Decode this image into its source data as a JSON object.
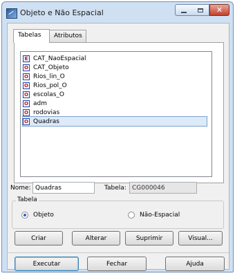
{
  "window": {
    "title": "Objeto e Não Espacial"
  },
  "tabs": [
    {
      "label": "Tabelas"
    },
    {
      "label": "Atributos"
    }
  ],
  "list": {
    "items": [
      {
        "icon": "E",
        "label": "CAT_NaoEspacial"
      },
      {
        "icon": "O",
        "label": "CAT_Objeto"
      },
      {
        "icon": "O",
        "label": "Rios_lin_O"
      },
      {
        "icon": "O",
        "label": "Rios_pol_O"
      },
      {
        "icon": "O",
        "label": "escolas_O"
      },
      {
        "icon": "O",
        "label": "adm"
      },
      {
        "icon": "O",
        "label": "rodovias"
      },
      {
        "icon": "O",
        "label": "Quadras"
      }
    ],
    "selected": "Quadras"
  },
  "fields": {
    "nome_label": "Nome:",
    "nome_value": "Quadras",
    "tabela_label": "Tabela:",
    "tabela_value": "CG000046"
  },
  "tabela_group": {
    "title": "Tabela",
    "options": [
      {
        "label": "Objeto",
        "checked": true
      },
      {
        "label": "Não-Espacial",
        "checked": false
      }
    ]
  },
  "buttons": {
    "criar": "Criar",
    "alterar": "Alterar",
    "suprimir": "Suprimir",
    "visual": "Visual...",
    "executar": "Executar",
    "fechar": "Fechar",
    "ajuda": "Ajuda"
  }
}
